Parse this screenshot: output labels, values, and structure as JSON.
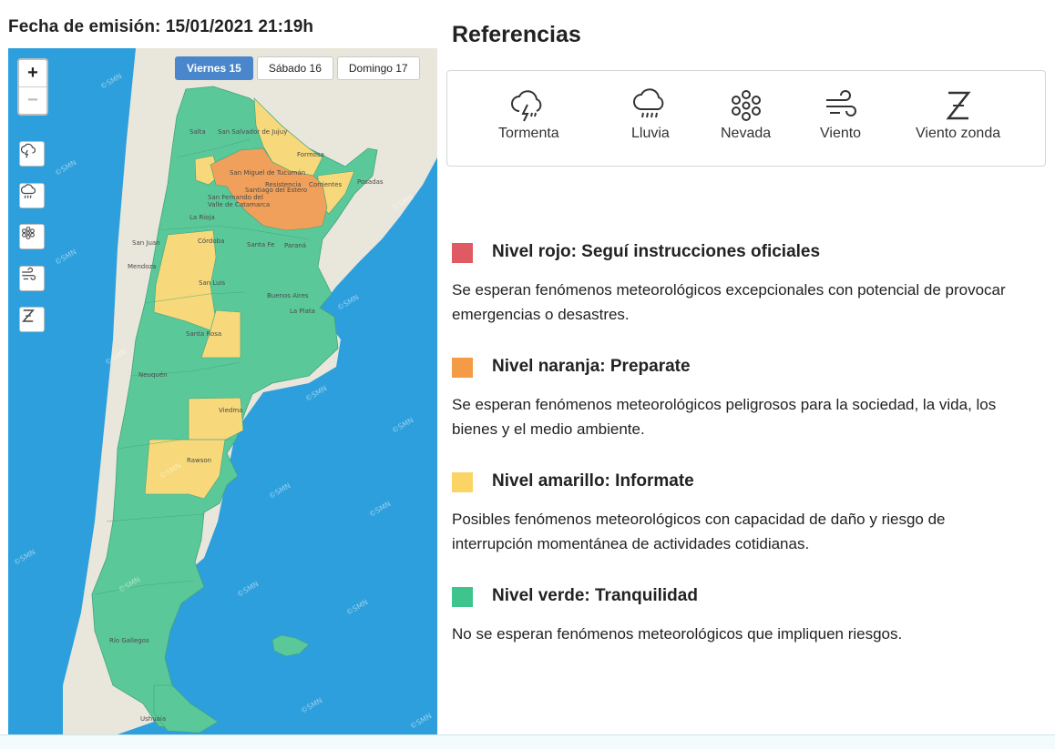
{
  "header": {
    "issued_text": "Fecha de emisión: 15/01/2021 21:19h"
  },
  "map": {
    "day_tabs": [
      {
        "label": "Viernes 15",
        "active": true
      },
      {
        "label": "Sábado 16",
        "active": false
      },
      {
        "label": "Domingo 17",
        "active": false
      }
    ],
    "zoom_in_label": "+",
    "zoom_out_label": "−",
    "layer_buttons": [
      "thunderstorm-icon",
      "rain-icon",
      "snow-icon",
      "wind-icon",
      "zonda-wind-icon"
    ],
    "watermark": "©SMN",
    "cities": {
      "salta": "Salta",
      "jujuy": "San Salvador de Jujuy",
      "formosa": "Formosa",
      "tucuman": "San Miguel de Tucumán",
      "resistencia": "Resistencia",
      "corrientes": "Corrientes",
      "posadas": "Posadas",
      "santiago": "Santiago del Estero",
      "catamarca": "San Fernando del Valle de Catamarca",
      "larioja": "La Rioja",
      "sanjuan": "San Juan",
      "cordoba": "Córdoba",
      "santafe": "Santa Fe",
      "parana": "Paraná",
      "mendoza": "Mendoza",
      "sanluis": "San Luis",
      "buenosaires": "Buenos Aires",
      "laplata": "La Plata",
      "santarosa": "Santa Rosa",
      "neuquen": "Neuquén",
      "viedma": "Viedma",
      "rawson": "Rawson",
      "riogallegos": "Río Gallegos",
      "ushuaia": "Ushuaia"
    },
    "colors": {
      "sea": "#2d9fdc",
      "land": "#e9e6dc",
      "green": "#5bc89a",
      "yellow": "#f7d87a",
      "orange": "#f0a05a"
    }
  },
  "references": {
    "title": "Referencias",
    "items": [
      {
        "label": "Tormenta",
        "icon": "thunderstorm-icon"
      },
      {
        "label": "Lluvia",
        "icon": "rain-icon"
      },
      {
        "label": "Nevada",
        "icon": "snow-icon"
      },
      {
        "label": "Viento",
        "icon": "wind-icon"
      },
      {
        "label": "Viento zonda",
        "icon": "zonda-wind-icon"
      }
    ]
  },
  "levels": [
    {
      "color": "#e05a64",
      "title": "Nivel rojo: Seguí instrucciones oficiales",
      "description": "Se esperan fenómenos meteorológicos excepcionales con potencial de provocar emergencias o desastres."
    },
    {
      "color": "#f59a45",
      "title": "Nivel naranja: Preparate",
      "description": "Se esperan fenómenos meteorológicos peligrosos para la sociedad, la vida, los bienes y el medio ambiente."
    },
    {
      "color": "#fbd466",
      "title": "Nivel amarillo: Informate",
      "description": "Posibles fenómenos meteorológicos con capacidad de daño y riesgo de interrupción momentánea de actividades cotidianas."
    },
    {
      "color": "#3ec48c",
      "title": "Nivel verde: Tranquilidad",
      "description": "No se esperan fenómenos meteorológicos que impliquen riesgos."
    }
  ]
}
